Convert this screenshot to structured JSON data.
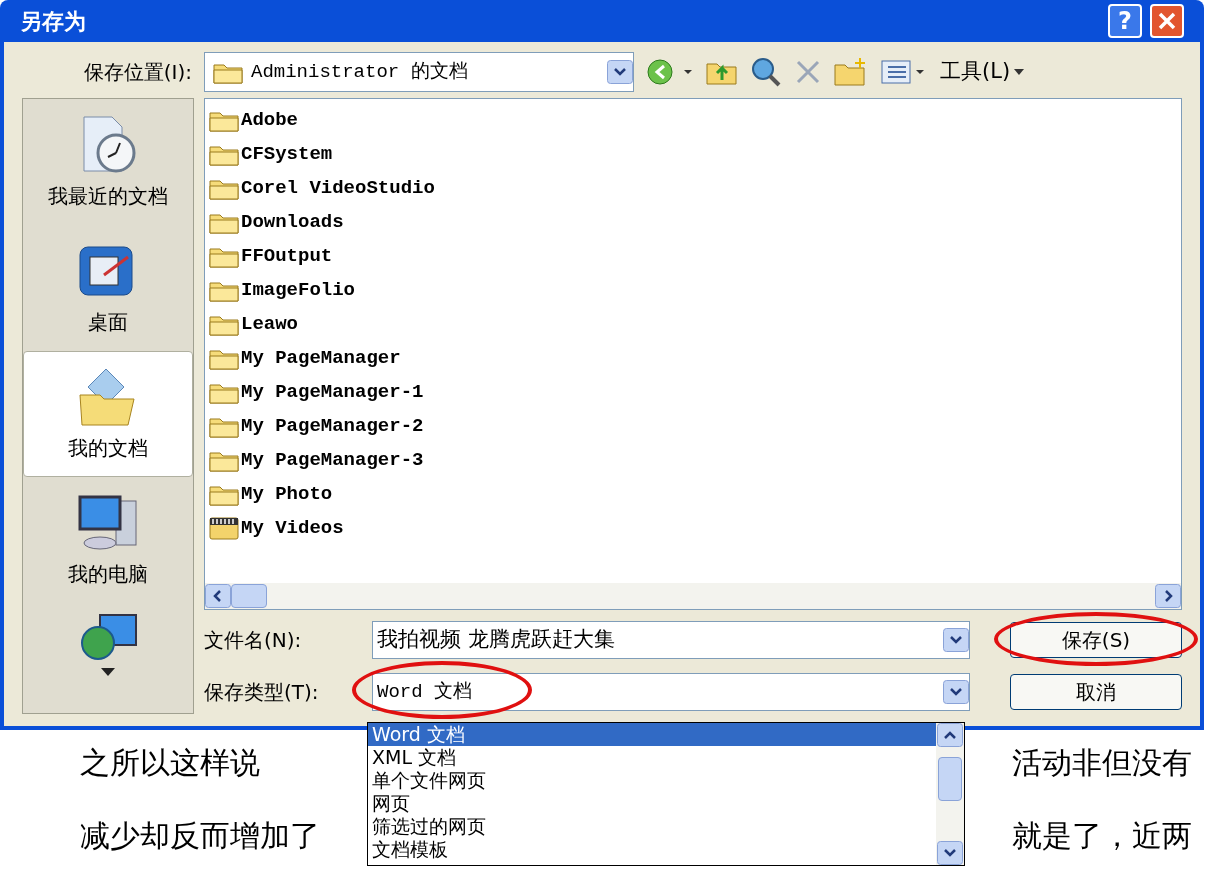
{
  "window": {
    "title": "另存为",
    "help": "?"
  },
  "location": {
    "label": "保存位置(I):",
    "value": "Administrator 的文档",
    "tools": "工具(L)"
  },
  "places": [
    {
      "label": "我最近的文档",
      "kind": "recent",
      "selected": false
    },
    {
      "label": "桌面",
      "kind": "desktop",
      "selected": false
    },
    {
      "label": "我的文档",
      "kind": "documents",
      "selected": true
    },
    {
      "label": "我的电脑",
      "kind": "computer",
      "selected": false
    }
  ],
  "files": [
    {
      "name": "Adobe",
      "kind": "folder"
    },
    {
      "name": "CFSystem",
      "kind": "folder"
    },
    {
      "name": "Corel VideoStudio",
      "kind": "folder"
    },
    {
      "name": "Downloads",
      "kind": "folder"
    },
    {
      "name": "FFOutput",
      "kind": "folder"
    },
    {
      "name": "ImageFolio",
      "kind": "folder"
    },
    {
      "name": "Leawo",
      "kind": "folder"
    },
    {
      "name": "My PageManager",
      "kind": "folder"
    },
    {
      "name": "My PageManager-1",
      "kind": "folder"
    },
    {
      "name": "My PageManager-2",
      "kind": "folder"
    },
    {
      "name": "My PageManager-3",
      "kind": "folder"
    },
    {
      "name": "My Photo",
      "kind": "folder"
    },
    {
      "name": "My Videos",
      "kind": "video"
    }
  ],
  "filename": {
    "label": "文件名(N):",
    "value": "我拍视频 龙腾虎跃赶大集"
  },
  "filetype": {
    "label": "保存类型(T):",
    "value": "Word 文档",
    "circled": true,
    "expanded": true,
    "options": [
      {
        "label": "Word 文档",
        "selected": true
      },
      {
        "label": "XML 文档",
        "selected": false
      },
      {
        "label": "单个文件网页",
        "selected": false
      },
      {
        "label": "网页",
        "selected": false
      },
      {
        "label": "筛选过的网页",
        "selected": false
      },
      {
        "label": "文档模板",
        "selected": false
      }
    ]
  },
  "buttons": [
    {
      "label": "保存(S)",
      "circled": true
    },
    {
      "label": "取消",
      "circled": false
    }
  ],
  "document_lines": [
    {
      "left": "之所以这样说",
      "right": "活动非但没有"
    },
    {
      "left": "减少却反而增加了",
      "right": "就是了，近两"
    }
  ]
}
